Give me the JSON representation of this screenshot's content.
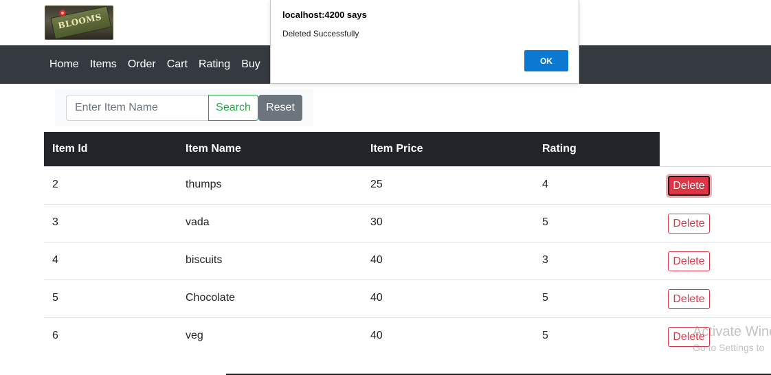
{
  "logo": {
    "text": "BLOOMS"
  },
  "nav": {
    "items": [
      {
        "label": "Home"
      },
      {
        "label": "Items"
      },
      {
        "label": "Order"
      },
      {
        "label": "Cart"
      },
      {
        "label": "Rating"
      },
      {
        "label": "Buy"
      }
    ]
  },
  "search": {
    "placeholder": "Enter Item Name",
    "value": "",
    "search_label": "Search",
    "reset_label": "Reset"
  },
  "table": {
    "headers": [
      "Item Id",
      "Item Name",
      "Item Price",
      "Rating"
    ],
    "delete_label": "Delete",
    "rows": [
      {
        "id": "2",
        "name": "thumps",
        "price": "25",
        "rating": "4"
      },
      {
        "id": "3",
        "name": "vada",
        "price": "30",
        "rating": "5"
      },
      {
        "id": "4",
        "name": "biscuits",
        "price": "40",
        "rating": "3"
      },
      {
        "id": "5",
        "name": "Chocolate",
        "price": "40",
        "rating": "5"
      },
      {
        "id": "6",
        "name": "veg",
        "price": "40",
        "rating": "5"
      }
    ]
  },
  "dialog": {
    "title": "localhost:4200 says",
    "message": "Deleted Successfully",
    "ok_label": "OK"
  },
  "watermark": {
    "line1": "Activate Wind",
    "line2": "Go to Settings to"
  },
  "colors": {
    "navbar": "#343a40",
    "table_header": "#212529",
    "search_accent": "#28a745",
    "reset_button": "#6c757d",
    "delete_accent": "#dc3545",
    "dialog_ok": "#0b78d1"
  }
}
